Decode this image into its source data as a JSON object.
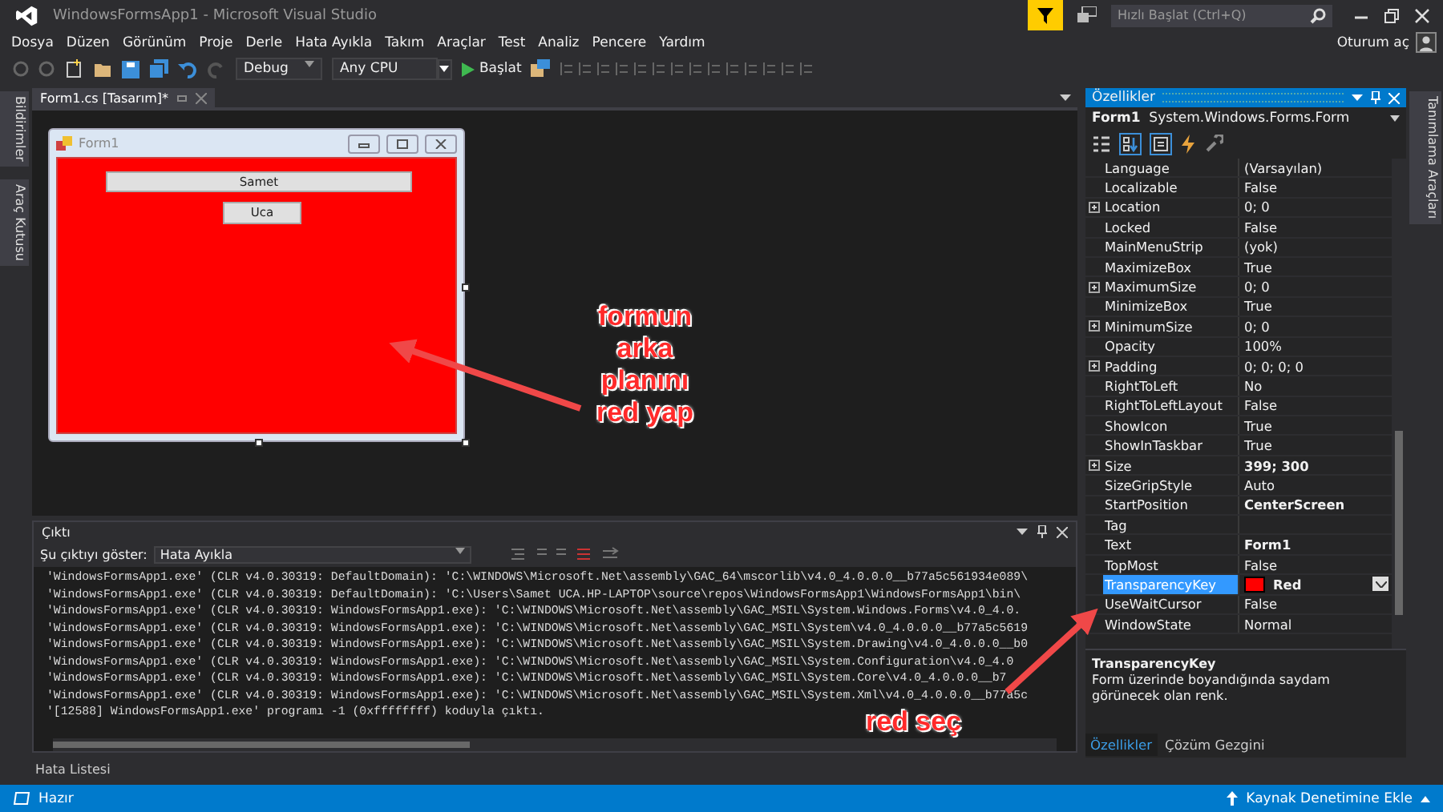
{
  "window": {
    "title": "WindowsFormsApp1 - Microsoft Visual Studio",
    "quick_launch": {
      "placeholder": "Hızlı Başlat (Ctrl+Q)"
    },
    "sign_in": "Oturum aç"
  },
  "menu": [
    "Dosya",
    "Düzen",
    "Görünüm",
    "Proje",
    "Derle",
    "Hata Ayıkla",
    "Takım",
    "Araçlar",
    "Test",
    "Analiz",
    "Pencere",
    "Yardım"
  ],
  "toolbar": {
    "configuration": "Debug",
    "platform": "Any CPU",
    "start": "Başlat"
  },
  "left_strip": [
    "Bildirimler",
    "Araç Kutusu"
  ],
  "right_strip": [
    "Tanımlama Araçları"
  ],
  "document_tab": {
    "title": "Form1.cs [Tasarım]*",
    "selected": true
  },
  "form": {
    "title": "Form1",
    "textbox": "Samet",
    "button": "Uca"
  },
  "output": {
    "title": "Çıktı",
    "source_label": "Şu çıktıyı göster:",
    "source": "Hata Ayıkla",
    "lines": [
      "'WindowsFormsApp1.exe' (CLR v4.0.30319: DefaultDomain): 'C:\\WINDOWS\\Microsoft.Net\\assembly\\GAC_64\\mscorlib\\v4.0_4.0.0.0__b77a5c561934e089\\",
      "'WindowsFormsApp1.exe' (CLR v4.0.30319: DefaultDomain): 'C:\\Users\\Samet UCA.HP-LAPTOP\\source\\repos\\WindowsFormsApp1\\WindowsFormsApp1\\bin\\",
      "'WindowsFormsApp1.exe' (CLR v4.0.30319: WindowsFormsApp1.exe): 'C:\\WINDOWS\\Microsoft.Net\\assembly\\GAC_MSIL\\System.Windows.Forms\\v4.0_4.0.",
      "'WindowsFormsApp1.exe' (CLR v4.0.30319: WindowsFormsApp1.exe): 'C:\\WINDOWS\\Microsoft.Net\\assembly\\GAC_MSIL\\System\\v4.0_4.0.0.0__b77a5c5619",
      "'WindowsFormsApp1.exe' (CLR v4.0.30319: WindowsFormsApp1.exe): 'C:\\WINDOWS\\Microsoft.Net\\assembly\\GAC_MSIL\\System.Drawing\\v4.0_4.0.0.0__b0",
      "'WindowsFormsApp1.exe' (CLR v4.0.30319: WindowsFormsApp1.exe): 'C:\\WINDOWS\\Microsoft.Net\\assembly\\GAC_MSIL\\System.Configuration\\v4.0_4.0",
      "'WindowsFormsApp1.exe' (CLR v4.0.30319: WindowsFormsApp1.exe): 'C:\\WINDOWS\\Microsoft.Net\\assembly\\GAC_MSIL\\System.Core\\v4.0_4.0.0.0__b7",
      "'WindowsFormsApp1.exe' (CLR v4.0.30319: WindowsFormsApp1.exe): 'C:\\WINDOWS\\Microsoft.Net\\assembly\\GAC_MSIL\\System.Xml\\v4.0_4.0.0.0__b77a5c",
      "'[12588] WindowsFormsApp1.exe' programı -1 (0xffffffff) koduyla çıktı."
    ]
  },
  "bottom_tab": "Hata Listesi",
  "properties": {
    "title": "Özellikler",
    "object_name": "Form1",
    "object_type": "System.Windows.Forms.Form",
    "rows": [
      {
        "name": "Language",
        "value": "(Varsayılan)",
        "expandable": false,
        "selected": false
      },
      {
        "name": "Localizable",
        "value": "False",
        "expandable": false,
        "selected": false
      },
      {
        "name": "Location",
        "value": "0; 0",
        "expandable": true,
        "selected": false
      },
      {
        "name": "Locked",
        "value": "False",
        "expandable": false,
        "selected": false
      },
      {
        "name": "MainMenuStrip",
        "value": "(yok)",
        "expandable": false,
        "selected": false
      },
      {
        "name": "MaximizeBox",
        "value": "True",
        "expandable": false,
        "selected": false
      },
      {
        "name": "MaximumSize",
        "value": "0; 0",
        "expandable": true,
        "selected": false
      },
      {
        "name": "MinimizeBox",
        "value": "True",
        "expandable": false,
        "selected": false
      },
      {
        "name": "MinimumSize",
        "value": "0; 0",
        "expandable": true,
        "selected": false
      },
      {
        "name": "Opacity",
        "value": "100%",
        "expandable": false,
        "selected": false
      },
      {
        "name": "Padding",
        "value": "0; 0; 0; 0",
        "expandable": true,
        "selected": false
      },
      {
        "name": "RightToLeft",
        "value": "No",
        "expandable": false,
        "selected": false
      },
      {
        "name": "RightToLeftLayout",
        "value": "False",
        "expandable": false,
        "selected": false
      },
      {
        "name": "ShowIcon",
        "value": "True",
        "expandable": false,
        "selected": false
      },
      {
        "name": "ShowInTaskbar",
        "value": "True",
        "expandable": false,
        "selected": false
      },
      {
        "name": "Size",
        "value": "399; 300",
        "expandable": true,
        "bold": true,
        "selected": false
      },
      {
        "name": "SizeGripStyle",
        "value": "Auto",
        "expandable": false,
        "selected": false
      },
      {
        "name": "StartPosition",
        "value": "CenterScreen",
        "expandable": false,
        "bold": true,
        "selected": false
      },
      {
        "name": "Tag",
        "expandable": false,
        "selected": false
      },
      {
        "name": "Text",
        "value": "Form1",
        "expandable": false,
        "bold": true,
        "selected": false
      },
      {
        "name": "TopMost",
        "value": "False",
        "expandable": false,
        "selected": false
      },
      {
        "name": "TransparencyKey",
        "value": "Red",
        "color": "#ff0000",
        "expandable": false,
        "bold": true,
        "selected": true
      },
      {
        "name": "UseWaitCursor",
        "value": "False",
        "expandable": false,
        "selected": false
      },
      {
        "name": "WindowState",
        "value": "Normal",
        "expandable": false,
        "selected": false
      }
    ],
    "description_title": "TransparencyKey",
    "description": "Form üzerinde boyandığında saydam görünecek olan renk.",
    "tabs": [
      {
        "label": "Özellikler",
        "selected": true
      },
      {
        "label": "Çözüm Gezgini",
        "selected": false
      }
    ]
  },
  "status_bar": {
    "text": "Hazır",
    "source_control": "Kaynak Denetimine Ekle"
  },
  "annotations": [
    {
      "lines": [
        "formun",
        "arka",
        "planını",
        "red yap"
      ]
    },
    {
      "lines": [
        "red seç"
      ]
    }
  ]
}
